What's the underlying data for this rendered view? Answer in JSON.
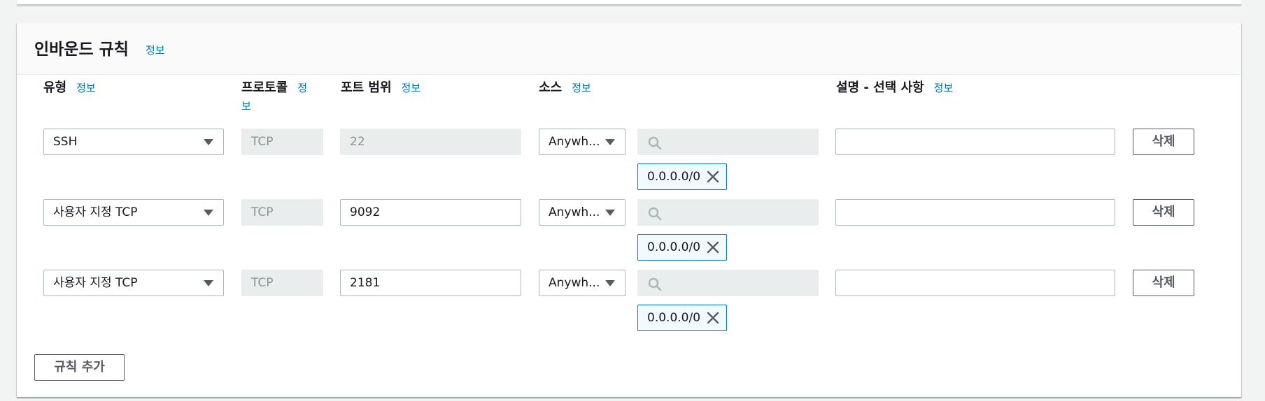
{
  "panel": {
    "title": "인바운드 규칙",
    "title_info": "정보"
  },
  "columns": {
    "type": {
      "label": "유형",
      "info": "정보"
    },
    "protocol": {
      "label": "프로토콜",
      "info_part1": "정",
      "info_part2": "보"
    },
    "port_range": {
      "label": "포트 범위",
      "info": "정보"
    },
    "source": {
      "label": "소스",
      "info": "정보"
    },
    "description": {
      "label": "설명 - 선택 사항",
      "info": "정보"
    }
  },
  "rules": [
    {
      "type": "SSH",
      "protocol": "TCP",
      "port": "22",
      "port_disabled": true,
      "source": "Anywh...",
      "cidr": "0.0.0.0/0",
      "description": "",
      "delete_label": "삭제"
    },
    {
      "type": "사용자 지정 TCP",
      "protocol": "TCP",
      "port": "9092",
      "port_disabled": false,
      "source": "Anywh...",
      "cidr": "0.0.0.0/0",
      "description": "",
      "delete_label": "삭제"
    },
    {
      "type": "사용자 지정 TCP",
      "protocol": "TCP",
      "port": "2181",
      "port_disabled": false,
      "source": "Anywh...",
      "cidr": "0.0.0.0/0",
      "description": "",
      "delete_label": "삭제"
    }
  ],
  "add_rule_label": "규칙 추가",
  "colors": {
    "accent": "#0073bb",
    "token_bg": "#f1faff",
    "disabled_bg": "#eaeded"
  }
}
